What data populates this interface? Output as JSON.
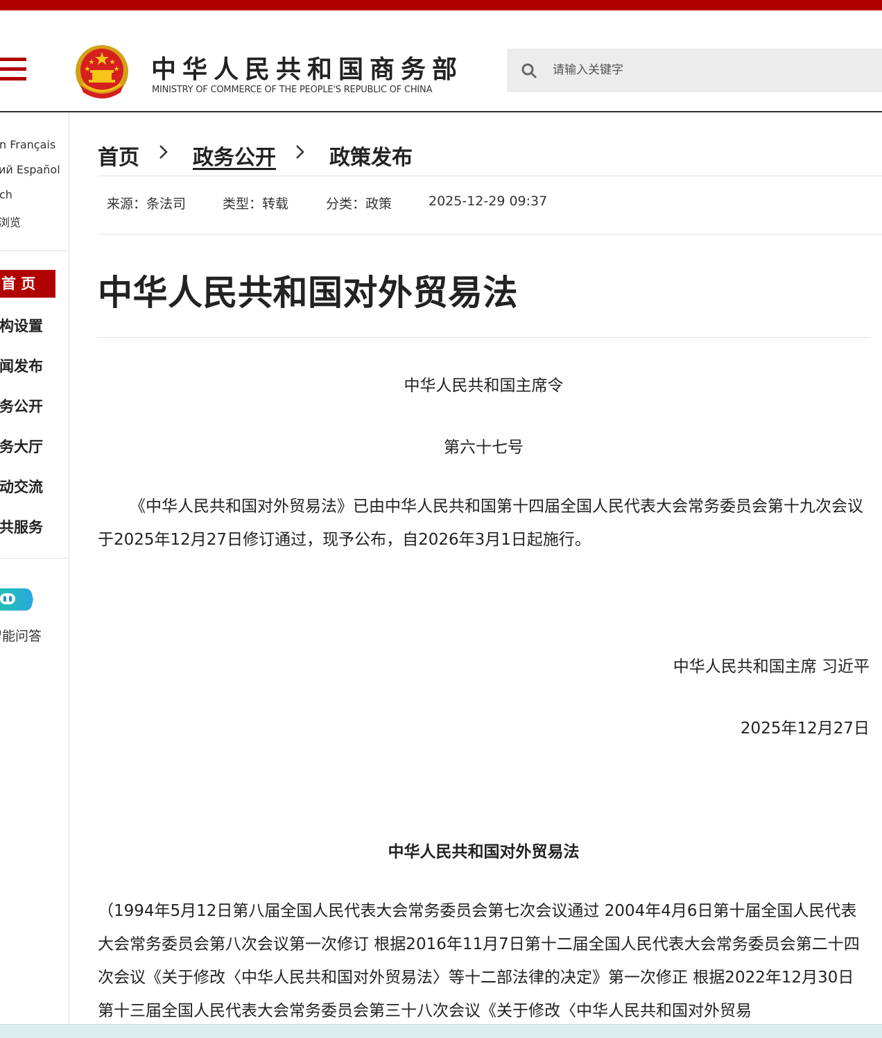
{
  "header": {
    "title_cn": "中华人民共和国商务部",
    "title_en": "MINISTRY OF COMMERCE OF THE PEOPLE'S REPUBLIC OF CHINA",
    "search_placeholder": "请输入关键字",
    "brand_color": "#b10000"
  },
  "sidebar": {
    "languages": [
      "n  Français",
      "ий  Español",
      "ch",
      "浏览"
    ],
    "nav": [
      {
        "label": "首 页",
        "active": true
      },
      {
        "label": "机构设置"
      },
      {
        "label": "新闻发布"
      },
      {
        "label": "政务公开"
      },
      {
        "label": "政务大厅"
      },
      {
        "label": "互动交流"
      },
      {
        "label": "公共服务"
      }
    ],
    "assistant_label": "智能问答",
    "assistant_icon": "robot-icon"
  },
  "breadcrumb": [
    "首页",
    "政务公开",
    "政策发布"
  ],
  "meta": {
    "source": "来源：条法司",
    "type": "类型：转载",
    "category": "分类：政策",
    "datetime": "2025-12-29 09:37"
  },
  "article": {
    "title": "中华人民共和国对外贸易法",
    "decree_heading": "中华人民共和国主席令",
    "decree_number": "第六十七号",
    "decree_text": "《中华人民共和国对外贸易法》已由中华人民共和国第十四届全国人民代表大会常务委员会第十九次会议于2025年12月27日修订通过，现予公布，自2026年3月1日起施行。",
    "signature": "中华人民共和国主席 习近平",
    "sign_date": "2025年12月27日",
    "law_title": "中华人民共和国对外贸易法",
    "history_text": "（1994年5月12日第八届全国人民代表大会常务委员会第七次会议通过 2004年4月6日第十届全国人民代表大会常务委员会第八次会议第一次修订 根据2016年11月7日第十二届全国人民代表大会常务委员会第二十四次会议《关于修改〈中华人民共和国对外贸易法〉等十二部法律的决定》第一次修正 根据2022年12月30日第十三届全国人民代表大会常务委员会第三十八次会议《关于修改〈中华人民共和国对外贸易"
  }
}
